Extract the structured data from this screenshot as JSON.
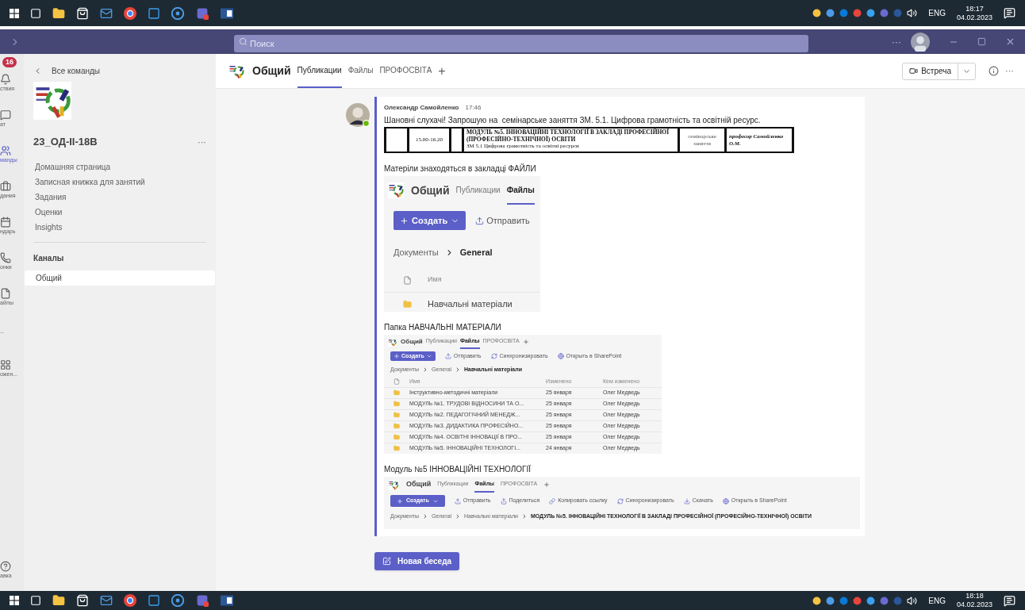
{
  "taskbar_top": {
    "language": "ENG",
    "time": "18:17",
    "date": "04.02.2023"
  },
  "title_bar": {
    "search": {
      "placeholder": "Поиск"
    },
    "more": "···"
  },
  "app_bar": {
    "badge": "16",
    "items": [
      {
        "label": "ствия",
        "selected": false
      },
      {
        "label": "ат",
        "selected": false
      },
      {
        "label": "манды",
        "selected": true
      },
      {
        "label": "дания",
        "selected": false
      },
      {
        "label": "ндарь",
        "selected": false
      },
      {
        "label": "онки",
        "selected": false
      },
      {
        "label": "айлы",
        "selected": false
      },
      {
        "label": "··",
        "selected": false
      },
      {
        "label": "ожен...",
        "selected": false
      }
    ],
    "help": "авка"
  },
  "sidebar": {
    "back": "Все команды",
    "team_name": "23_ОД-II-18В",
    "more": "···",
    "items": [
      {
        "label": "Домашняя страница"
      },
      {
        "label": "Записная книжка для занятий"
      },
      {
        "label": "Задания"
      },
      {
        "label": "Оценки"
      },
      {
        "label": "Insights"
      }
    ],
    "channels_heading": "Каналы",
    "channels": [
      {
        "label": "Общий",
        "selected": true
      }
    ]
  },
  "channel_header": {
    "title": "Общий",
    "tabs": [
      {
        "label": "Публикации",
        "selected": true
      },
      {
        "label": "Файлы",
        "selected": false
      },
      {
        "label": "ПРОФОСВІТА",
        "selected": false
      }
    ],
    "add": "+",
    "meet_button": "Встреча",
    "more": "···"
  },
  "message": {
    "author": "Олександр Самойленко",
    "time": "17:46",
    "text": "Шановні слухачі! Запрошую на  семінарське заняття ЗМ. 5.1. Цифрова грамотність та освітній ресурс.",
    "schedule": {
      "time": "15.00-16.20",
      "title": "МОДУЛЬ №5. ІННОВАЦІЙНІ ТЕХНОЛОГІЇ В ЗАКЛАДІ ПРОФЕСІЙНОЇ (ПРОФЕСІЙНО-ТЕХНІЧНОЇ) ОСВІТИ",
      "subtitle": "ЗМ 5.1 Цифрова грамотність та освітні ресурси",
      "type": "семінарське заняття",
      "teacher": "професор Самойленко О.М."
    },
    "blocks": [
      {
        "caption": "Матеріли знаходяться в закладці ФАЙЛИ",
        "shot": {
          "title": "Общий",
          "tabs": [
            {
              "label": "Публикации",
              "selected": false
            },
            {
              "label": "Файлы",
              "selected": true
            }
          ],
          "create": "Создать",
          "actions": [
            {
              "label": "Отправить",
              "kind": "upload"
            }
          ],
          "breadcrumb": [
            "Документы",
            "General"
          ],
          "columns": [
            "Имя"
          ],
          "rows": [
            {
              "cells": [
                "Навчальні матеріали"
              ]
            }
          ]
        }
      },
      {
        "caption": "Папка НАВЧАЛЬНІ МАТЕРІАЛИ",
        "shot": {
          "title": "Общий",
          "tabs": [
            {
              "label": "Публикации",
              "selected": false
            },
            {
              "label": "Файлы",
              "selected": true
            },
            {
              "label": "ПРОФОСВІТА",
              "selected": false
            }
          ],
          "create": "Создать",
          "actions": [
            {
              "label": "Отправить",
              "kind": "upload"
            },
            {
              "label": "Синхронизировать",
              "kind": "sync"
            },
            {
              "label": "Открыть в SharePoint",
              "kind": "globe"
            }
          ],
          "breadcrumb": [
            "Документы",
            "General",
            "Навчальні матеріали"
          ],
          "columns": [
            "Имя",
            "Изменено",
            "Кем изменено"
          ],
          "rows": [
            {
              "cells": [
                "Інструктивно-методичні матеріали",
                "25 января",
                "Олег Медведь"
              ]
            },
            {
              "cells": [
                "МОДУЛЬ №1. ТРУДОВІ ВІДНОСИНИ ТА О...",
                "25 января",
                "Олег Медведь"
              ]
            },
            {
              "cells": [
                "МОДУЛЬ №2. ПЕДАГОГІЧНИЙ МЕНЕДЖ...",
                "25 января",
                "Олег Медведь"
              ]
            },
            {
              "cells": [
                "МОДУЛЬ №3. ДИДАКТИКА ПРОФЕСІЙНО...",
                "25 января",
                "Олег Медведь"
              ]
            },
            {
              "cells": [
                "МОДУЛЬ №4. ОСВІТНІ ІННОВАЦІЇ В ПРО...",
                "25 января",
                "Олег Медведь"
              ]
            },
            {
              "cells": [
                "МОДУЛЬ №5. ІННОВАЦІЙНІ ТЕХНОЛОГІ...",
                "24 января",
                "Олег Медведь"
              ]
            }
          ]
        }
      },
      {
        "caption": "Модуль №5 ІННОВАЦІЙНІ ТЕХНОЛОГІЇ",
        "shot": {
          "title": "Общий",
          "tabs": [
            {
              "label": "Публикации",
              "selected": false
            },
            {
              "label": "Файлы",
              "selected": true
            },
            {
              "label": "ПРОФОСВІТА",
              "selected": false
            }
          ],
          "create": "Создать",
          "actions": [
            {
              "label": "Отправить",
              "kind": "upload"
            },
            {
              "label": "Поделиться",
              "kind": "share"
            },
            {
              "label": "Копировать ссылку",
              "kind": "link"
            },
            {
              "label": "Синхронизировать",
              "kind": "sync"
            },
            {
              "label": "Скачать",
              "kind": "download"
            },
            {
              "label": "Открыть в SharePoint",
              "kind": "globe"
            }
          ],
          "breadcrumb": [
            "Документы",
            "General",
            "Навчальні матеріали",
            "МОДУЛЬ №5. ІННОВАЦІЙНІ ТЕХНОЛОГІЇ В ЗАКЛАДІ ПРОФЕСІЙНОЇ (ПРОФЕСІЙНО-ТЕХНІЧНОЇ) ОСВІТИ"
          ]
        }
      }
    ]
  },
  "new_conversation_button": "Новая беседа",
  "taskbar_bottom": {
    "language": "ENG",
    "time": "18:18",
    "date": "04.02.2023"
  }
}
